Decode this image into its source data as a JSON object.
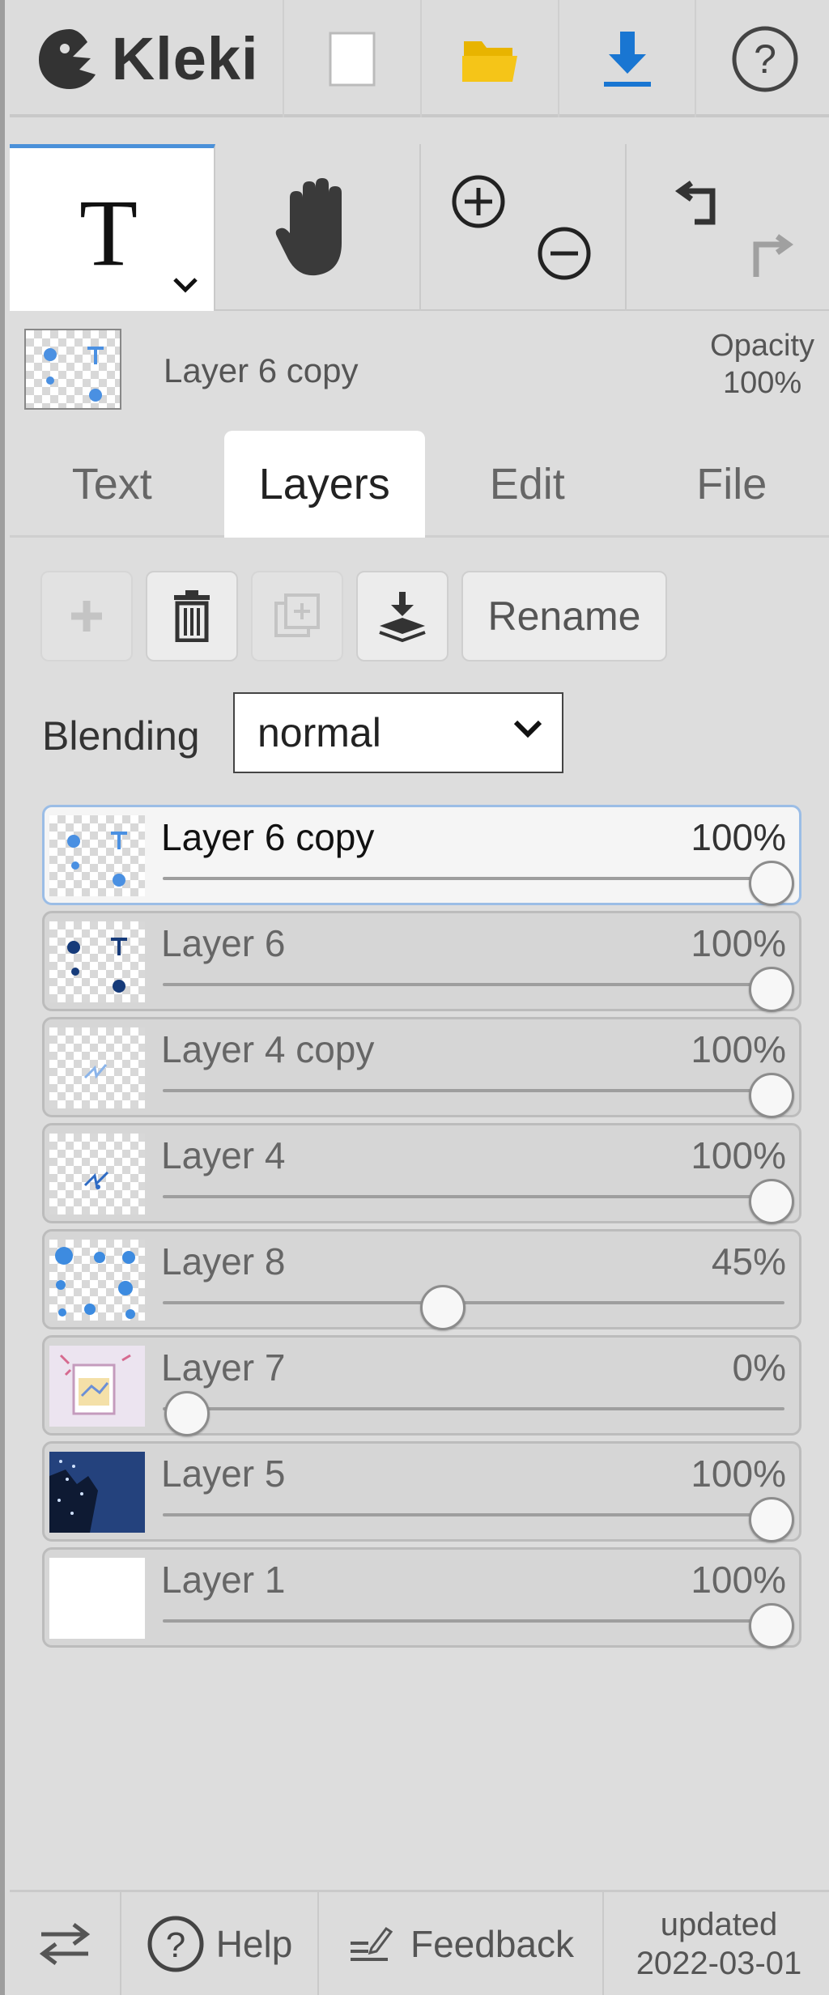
{
  "app": {
    "name": "Kleki"
  },
  "topbar": {
    "icons": [
      "kleki-logo-icon",
      "new-file-icon",
      "open-folder-icon",
      "download-icon",
      "help-circle-icon"
    ]
  },
  "tools": {
    "items": [
      "text-tool-icon",
      "hand-tool-icon",
      "zoom-in-out-icon",
      "undo-redo-icon"
    ]
  },
  "current_layer": {
    "name": "Layer 6 copy",
    "opacity_label": "Opacity",
    "opacity_value": "100%"
  },
  "tabs": [
    {
      "label": "Text"
    },
    {
      "label": "Layers",
      "active": true
    },
    {
      "label": "Edit"
    },
    {
      "label": "File"
    }
  ],
  "actions": {
    "rename_label": "Rename"
  },
  "blending": {
    "label": "Blending",
    "value": "normal"
  },
  "layers": [
    {
      "name": "Layer 6 copy",
      "opacity": "100%",
      "level": 1.0,
      "selected": true
    },
    {
      "name": "Layer 6",
      "opacity": "100%",
      "level": 1.0
    },
    {
      "name": "Layer 4 copy",
      "opacity": "100%",
      "level": 1.0
    },
    {
      "name": "Layer 4",
      "opacity": "100%",
      "level": 1.0
    },
    {
      "name": "Layer 8",
      "opacity": "45%",
      "level": 0.45
    },
    {
      "name": "Layer 7",
      "opacity": "0%",
      "level": 0.0
    },
    {
      "name": "Layer 5",
      "opacity": "100%",
      "level": 1.0
    },
    {
      "name": "Layer 1",
      "opacity": "100%",
      "level": 1.0
    }
  ],
  "footer": {
    "help_label": "Help",
    "feedback_label": "Feedback",
    "updated_label": "updated",
    "updated_date": "2022-03-01"
  },
  "colors": {
    "accent": "#4a90d9",
    "download": "#1976d2",
    "folder": "#f5c518"
  }
}
